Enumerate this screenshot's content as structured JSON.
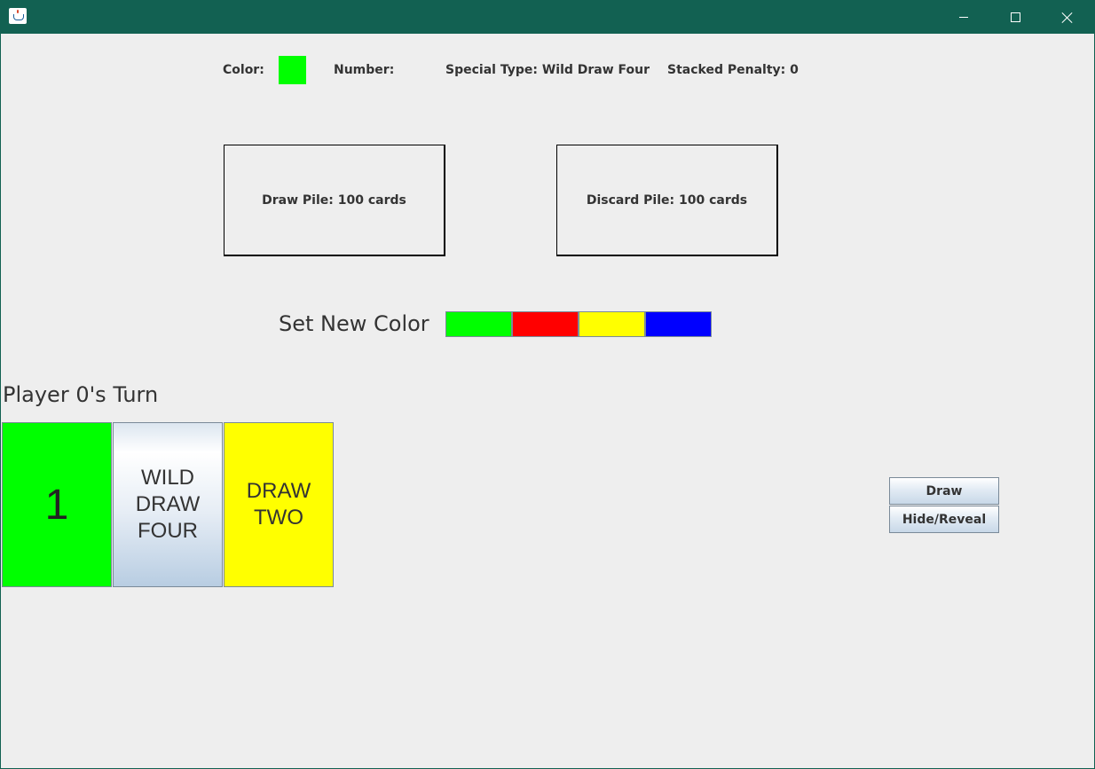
{
  "window": {
    "title": "",
    "titlebar_color": "#126152",
    "buttons": {
      "minimize": "minimize-icon",
      "maximize": "maximize-icon",
      "close": "close-icon"
    }
  },
  "status": {
    "color_label": "Color:",
    "color_value": "#00ff00",
    "number_label": "Number:",
    "special_type_label": "Special Type: Wild Draw Four",
    "stacked_penalty_label": "Stacked Penalty: 0"
  },
  "piles": {
    "draw_pile": "Draw Pile: 100 cards",
    "discard_pile": "Discard Pile: 100 cards"
  },
  "color_picker": {
    "label": "Set New Color",
    "options": [
      {
        "name": "green",
        "color": "#00ff00"
      },
      {
        "name": "red",
        "color": "#ff0000"
      },
      {
        "name": "yellow",
        "color": "#ffff00"
      },
      {
        "name": "blue",
        "color": "#0000ff"
      }
    ]
  },
  "turn": {
    "label": "Player 0's Turn"
  },
  "hand": {
    "cards": [
      {
        "text": "1",
        "color": "#00ff00"
      },
      {
        "text": "WILD\nDRAW\nFOUR",
        "color": "gradient"
      },
      {
        "text": "DRAW\nTWO",
        "color": "#ffff00"
      }
    ]
  },
  "actions": {
    "draw_label": "Draw",
    "hide_reveal_label": "Hide/Reveal"
  }
}
